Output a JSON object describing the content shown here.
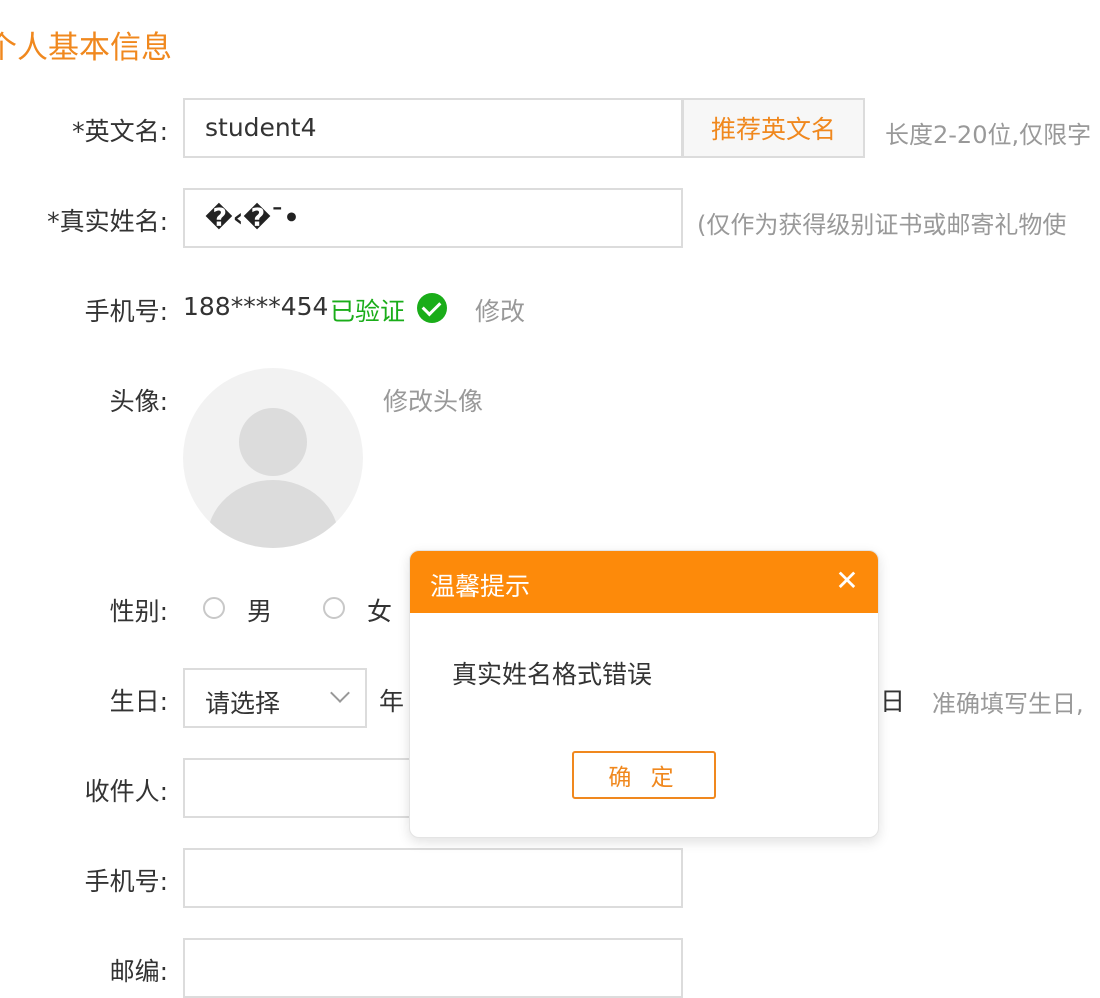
{
  "section_title": "个人基本信息",
  "form": {
    "english_name": {
      "label": "*英文名:",
      "value": "student4",
      "recommend_button": "推荐英文名",
      "hint": "长度2-20位,仅限字"
    },
    "real_name": {
      "label": "*真实姓名:",
      "value": "�‹�¯•",
      "hint": "(仅作为获得级别证书或邮寄礼物使"
    },
    "phone": {
      "label": "手机号:",
      "value": "188****454",
      "verified": "已验证",
      "edit_link": "修改"
    },
    "avatar": {
      "label": "头像:",
      "edit_link": "修改头像"
    },
    "gender": {
      "label": "性别:",
      "options": [
        "男",
        "女"
      ]
    },
    "birthday": {
      "label": "生日:",
      "select_placeholder": "请选择",
      "year_unit": "年",
      "day_unit": "日",
      "hint": "准确填写生日,"
    },
    "recipient": {
      "label": "收件人:"
    },
    "recipient_phone": {
      "label": "手机号:"
    },
    "postcode": {
      "label": "邮编:"
    }
  },
  "dialog": {
    "title": "温馨提示",
    "close_icon": "✕",
    "message": "真实姓名格式错误",
    "ok_button": "确 定"
  },
  "colors": {
    "accent": "#f0881e",
    "dialog_header": "#fd8a0a",
    "verified_green": "#1aad19",
    "hint_gray": "#999999"
  }
}
